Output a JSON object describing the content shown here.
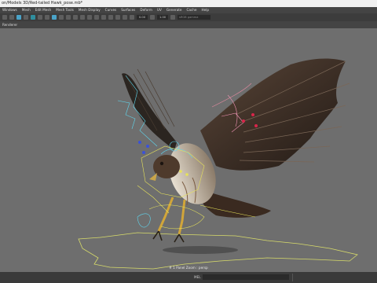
{
  "window": {
    "title": "on/Models 3D/Red-tailed Hawk_pose.mb*"
  },
  "menu": {
    "items": [
      "Windows",
      "Mesh",
      "Edit Mesh",
      "Mesh Tools",
      "Mesh Display",
      "Curves",
      "Surfaces",
      "Deform",
      "UV",
      "Generate",
      "Cache",
      "Help"
    ]
  },
  "toolbar": {
    "value_a": "0.00",
    "value_b": "1.00",
    "placeholder": "sRGB gamma"
  },
  "panel": {
    "menu_label": "Renderer"
  },
  "viewport": {
    "camera_label": "# 1 Panel Zoom : persp"
  },
  "statusbar": {
    "language": "MEL"
  }
}
